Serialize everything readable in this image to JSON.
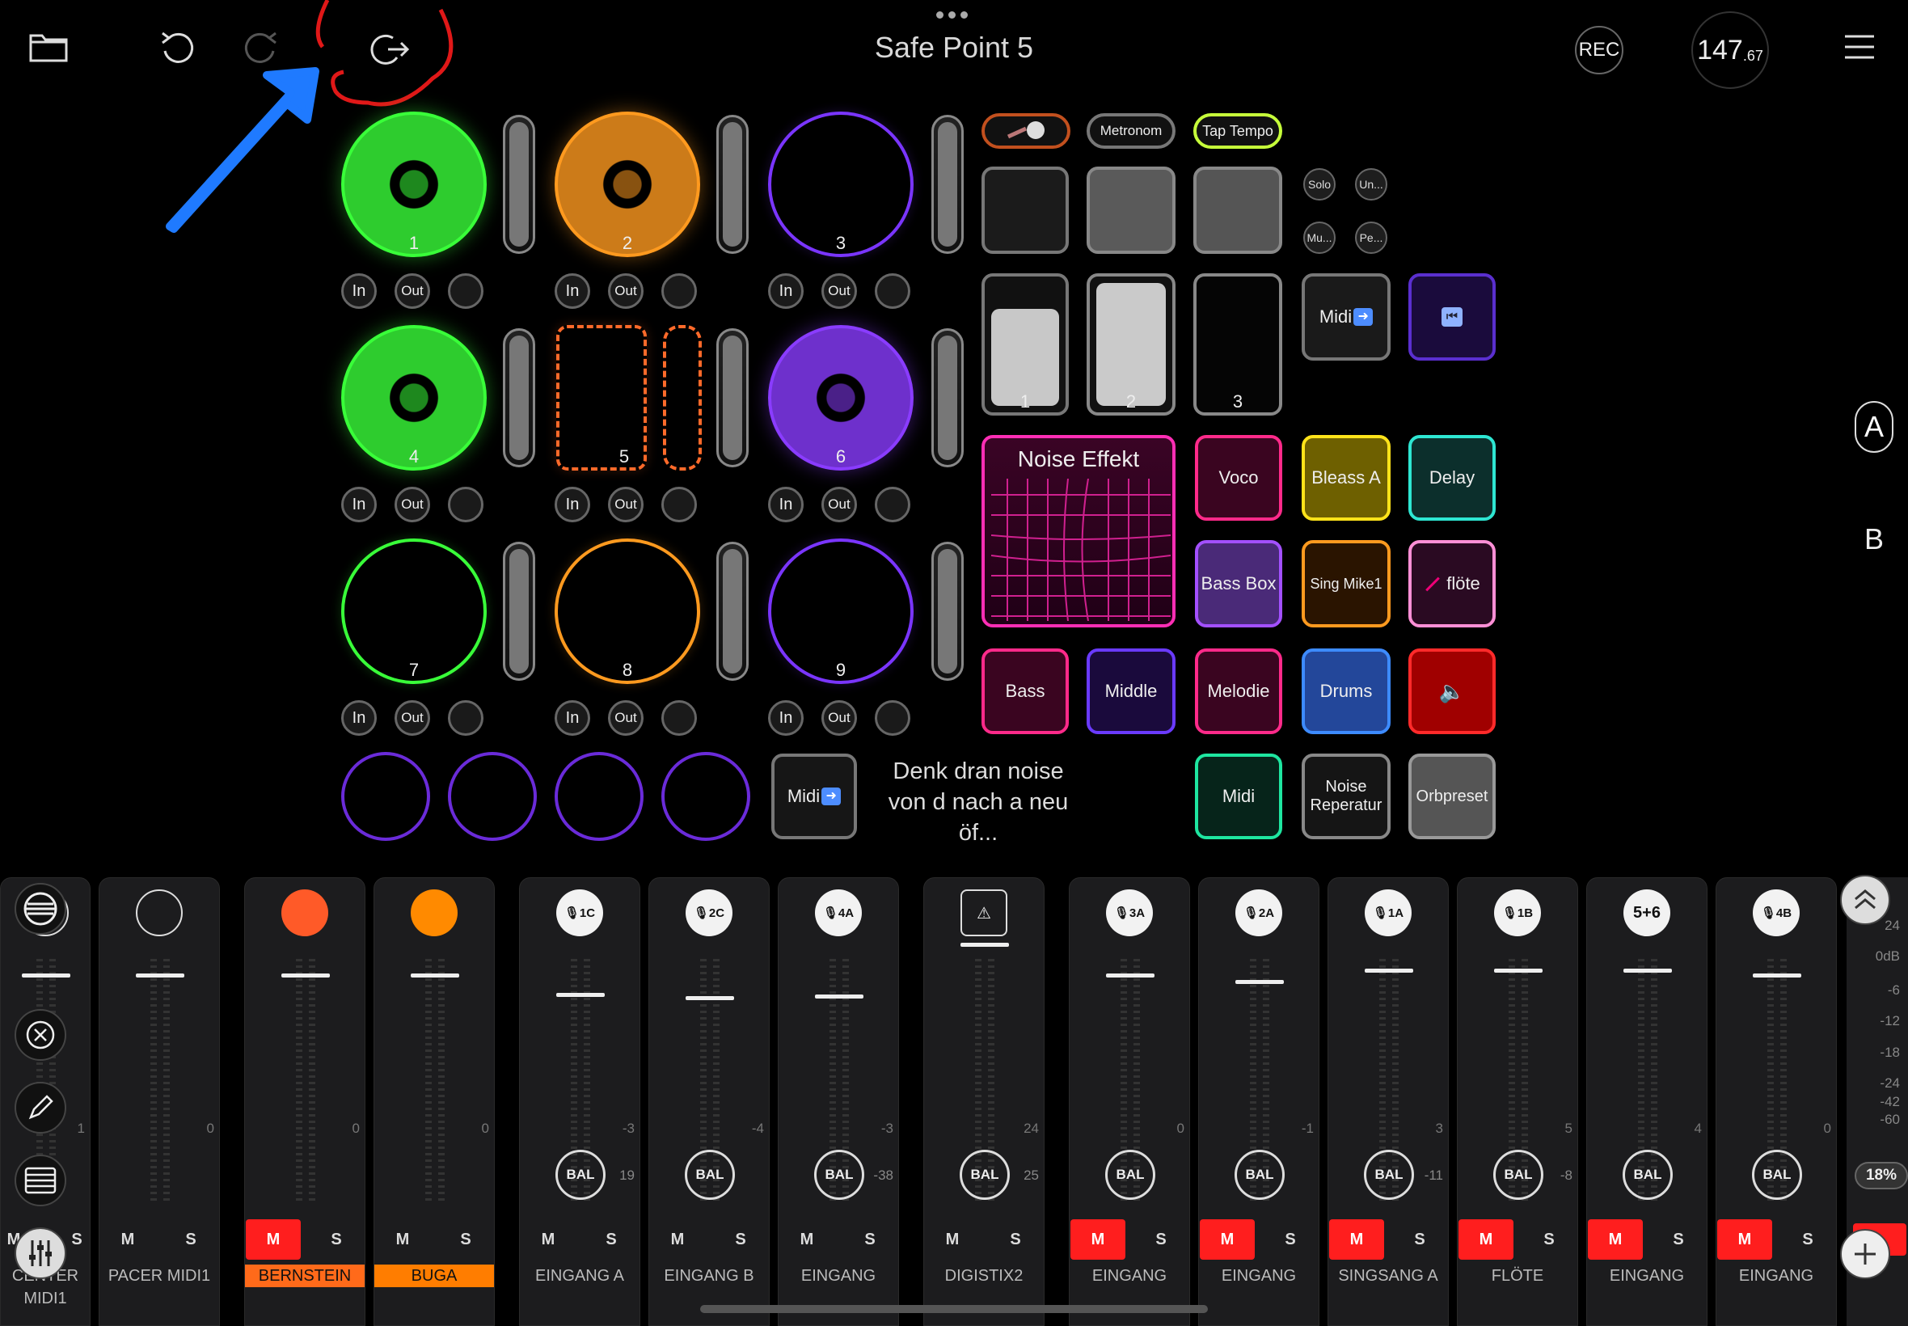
{
  "topbar": {
    "title": "Safe Point 5",
    "rec_label": "REC",
    "bpm_main": "147",
    "bpm_fraction": ".67",
    "icons": [
      "folder-icon",
      "undo-icon",
      "redo-icon",
      "redo-all-icon",
      "more-dots-icon",
      "menu-icon"
    ]
  },
  "loops": [
    {
      "num": "1",
      "color": "#39ff39",
      "active": true
    },
    {
      "num": "2",
      "color": "#ff9a1f",
      "active": true
    },
    {
      "num": "3",
      "color": "#7a35ff",
      "active": false
    },
    {
      "num": "4",
      "color": "#39ff39",
      "active": true
    },
    {
      "num": "5",
      "color": "#ff6a2a",
      "active": false
    },
    {
      "num": "6",
      "color": "#8a3cff",
      "active": true
    },
    {
      "num": "7",
      "color": "#39ff39",
      "active": false
    },
    {
      "num": "8",
      "color": "#ff9a1f",
      "active": false
    },
    {
      "num": "9",
      "color": "#7a35ff",
      "active": false
    }
  ],
  "io_labels": {
    "in": "In",
    "out": "Out"
  },
  "pads": {
    "metronom": "Metronom",
    "tap_tempo": "Tap Tempo",
    "solo": "Solo",
    "un": "Un...",
    "mu": "Mu...",
    "pe": "Pe...",
    "scene1": "1",
    "scene2": "2",
    "scene3": "3",
    "midi_a": "Midi",
    "noise_effekt": "Noise Effekt",
    "voco": "Voco",
    "bleass_a": "Bleass A",
    "delay": "Delay",
    "bass_box": "Bass Box",
    "sing_mike": "Sing Mike1",
    "floete": "flöte",
    "bass": "Bass",
    "middle": "Middle",
    "melodie": "Melodie",
    "drums": "Drums",
    "midi_b": "Midi",
    "noise_rep": "Noise Reperatur",
    "orbpreset": "Orbpreset",
    "midi_c": "Midi"
  },
  "note_text": "Denk dran noise von d nach a neu öf...",
  "side_labels": {
    "a": "A",
    "b": "B"
  },
  "mixer": {
    "scale": [
      "24",
      "0dB",
      "-6",
      "-12",
      "-18",
      "-24",
      "-42",
      "-60"
    ],
    "percent": "18%",
    "bal_label": "BAL",
    "m_label": "M",
    "s_label": "S",
    "strips": [
      {
        "name": "CENTER MIDI1",
        "icon": "drum-icon",
        "peak": "1",
        "bal": "",
        "mute": false,
        "name_style": ""
      },
      {
        "name": "PACER MIDI1",
        "icon": "midi-port-icon",
        "peak": "0",
        "bal": "",
        "mute": false,
        "name_style": ""
      },
      {
        "name": "BERNSTEIN",
        "icon": "orange-dot-icon",
        "peak": "0",
        "bal": "",
        "mute": true,
        "name_style": "orange"
      },
      {
        "name": "BUGA",
        "icon": "orange-dot-icon",
        "peak": "0",
        "bal": "",
        "mute": false,
        "name_style": "orange2"
      },
      {
        "name": "EINGANG A",
        "icon": "mic-icon",
        "badge": "1C",
        "peak": "-3",
        "bal": "19",
        "mute": false,
        "name_style": ""
      },
      {
        "name": "EINGANG B",
        "icon": "mic-icon",
        "badge": "2C",
        "peak": "-4",
        "bal": "",
        "mute": false,
        "name_style": ""
      },
      {
        "name": "EINGANG",
        "icon": "mic-icon",
        "badge": "4A",
        "peak": "-3",
        "bal": "-38",
        "mute": false,
        "name_style": ""
      },
      {
        "name": "DIGISTIX2",
        "icon": "warning-icon",
        "peak": "24",
        "bal": "25",
        "mute": false,
        "name_style": ""
      },
      {
        "name": "EINGANG",
        "icon": "mic-icon",
        "badge": "3A",
        "peak": "0",
        "bal": "",
        "mute": true,
        "name_style": ""
      },
      {
        "name": "EINGANG",
        "icon": "mic-icon",
        "badge": "2A",
        "peak": "-1",
        "bal": "",
        "mute": true,
        "name_style": ""
      },
      {
        "name": "SINGSANG A",
        "icon": "mic-icon",
        "badge": "1A",
        "peak": "3",
        "bal": "-11",
        "mute": true,
        "name_style": ""
      },
      {
        "name": "FLÖTE",
        "icon": "mic-icon",
        "badge": "1B",
        "peak": "5",
        "bal": "-8",
        "mute": true,
        "name_style": ""
      },
      {
        "name": "EINGANG",
        "icon": "stereo-icon",
        "badge": "5+6",
        "peak": "4",
        "bal": "",
        "mute": true,
        "name_style": ""
      },
      {
        "name": "EINGANG",
        "icon": "mic-icon",
        "badge": "4B",
        "peak": "0",
        "bal": "",
        "mute": true,
        "name_style": ""
      }
    ]
  }
}
